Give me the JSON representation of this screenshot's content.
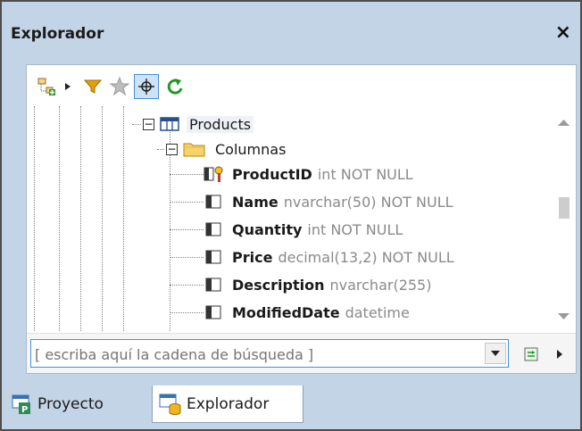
{
  "window": {
    "title": "Explorador",
    "close_label": "×"
  },
  "toolbar": {
    "buttons": [
      {
        "icon": "add-object-icon"
      },
      {
        "icon": "dropdown-arrow-icon"
      },
      {
        "icon": "filter-icon"
      },
      {
        "icon": "favorites-star-icon"
      },
      {
        "icon": "locate-crosshair-icon",
        "active": true
      },
      {
        "icon": "refresh-icon"
      }
    ]
  },
  "tree": {
    "table_node": {
      "label": "Products",
      "expander": "−"
    },
    "columns_node": {
      "label": "Columnas",
      "expander": "−"
    },
    "columns": [
      {
        "name": "ProductID",
        "type": "int NOT NULL",
        "icon": "primary-key-column-icon"
      },
      {
        "name": "Name",
        "type": "nvarchar(50) NOT NULL",
        "icon": "column-icon"
      },
      {
        "name": "Quantity",
        "type": "int NOT NULL",
        "icon": "column-icon"
      },
      {
        "name": "Price",
        "type": "decimal(13,2) NOT NULL",
        "icon": "column-icon"
      },
      {
        "name": "Description",
        "type": "nvarchar(255)",
        "icon": "column-icon"
      },
      {
        "name": "ModifiedDate",
        "type": "datetime",
        "icon": "column-icon"
      }
    ]
  },
  "search": {
    "placeholder": "[ escriba aquí la cadena de búsqueda ]",
    "value": ""
  },
  "tabs": [
    {
      "label": "Proyecto",
      "active": false
    },
    {
      "label": "Explorador",
      "active": true
    }
  ],
  "colors": {
    "panel_bg": "#c3d4e6",
    "accent": "#4a90d9",
    "filter": "#e8a000",
    "refresh": "#1f9a1f",
    "type_text": "#8a8a8a"
  }
}
